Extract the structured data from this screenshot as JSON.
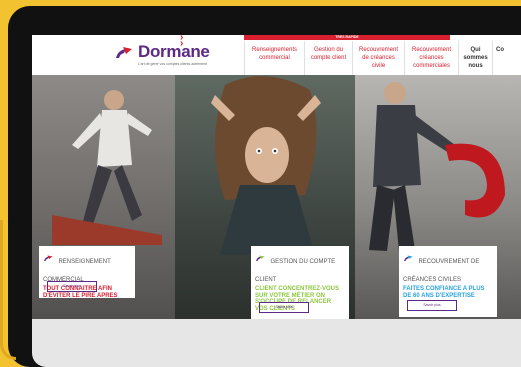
{
  "header": {
    "logo_text": "Dormane",
    "logo_tagline": "L'art de gérer vos comptes clients autrement",
    "banner": "TRÈS RAPIDE"
  },
  "nav": {
    "items": [
      {
        "line1": "Renseignements",
        "line2": "commercial",
        "line3": ""
      },
      {
        "line1": "Gestion du",
        "line2": "compte client",
        "line3": ""
      },
      {
        "line1": "Recouvrement",
        "line2": "de créances",
        "line3": "civile"
      },
      {
        "line1": "Recouvrement",
        "line2": "créances",
        "line3": "commerciales"
      },
      {
        "line1": "Qui",
        "line2": "sommes",
        "line3": "nous"
      },
      {
        "line1": "Co",
        "line2": "",
        "line3": ""
      }
    ]
  },
  "cards": [
    {
      "title": "Renseignement commercial",
      "subtitle": "TOUT CONNAITRE AFIN D'ÉVITER LE PIRE APRES",
      "subtitle_color": "#d8202f",
      "button": "Savoir plus"
    },
    {
      "title": "Gestion du compte client",
      "subtitle": "CLIENT CONCENTREZ-VOUS SUR VOTRE MÉTIER ON S'OCCUPE DE RELANCER VOS CLIENTS",
      "subtitle_color": "#8cc63f",
      "button": "Savoir plus"
    },
    {
      "title": "Recouvrement de créances civiles",
      "subtitle": "FAITES CONFIANCE A PLUS DE 60 ANS D'EXPERTISE",
      "subtitle_color": "#29a3e0",
      "button": "Savoir plus"
    }
  ],
  "colors": {
    "brand_purple": "#5b2a86",
    "brand_red": "#d8202f"
  }
}
